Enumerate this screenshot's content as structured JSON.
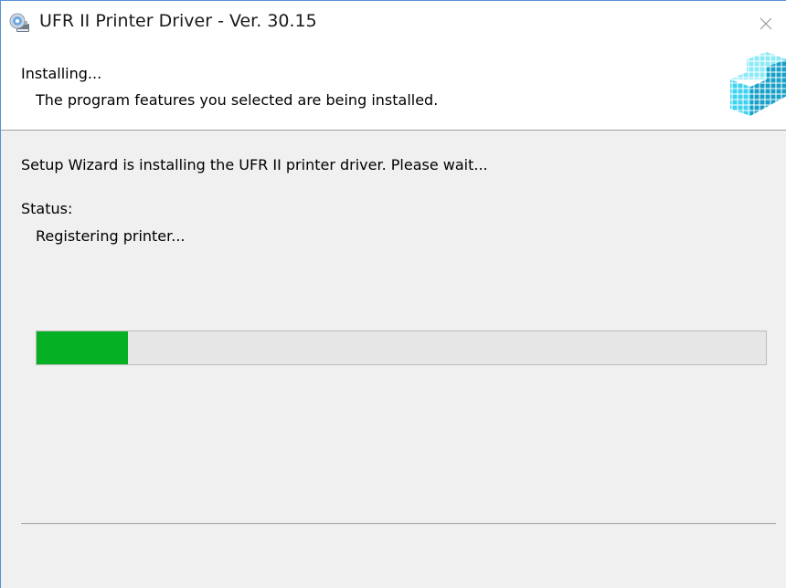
{
  "window": {
    "title": "UFR II Printer Driver - Ver. 30.15",
    "app_icon": "installer-disc-icon",
    "close_icon": "close-icon"
  },
  "header": {
    "title": "Installing...",
    "subtitle": "The program features you selected are being installed.",
    "logo_icon": "cube-grid-logo"
  },
  "main": {
    "message": "Setup Wizard is installing the UFR II printer driver. Please wait...",
    "status_label": "Status:",
    "status_value": "Registering printer...",
    "progress_percent": 12.5
  },
  "colors": {
    "progress_fill": "#06b025",
    "window_border": "#5a8fd6",
    "logo_accent": "#29c3e6"
  }
}
